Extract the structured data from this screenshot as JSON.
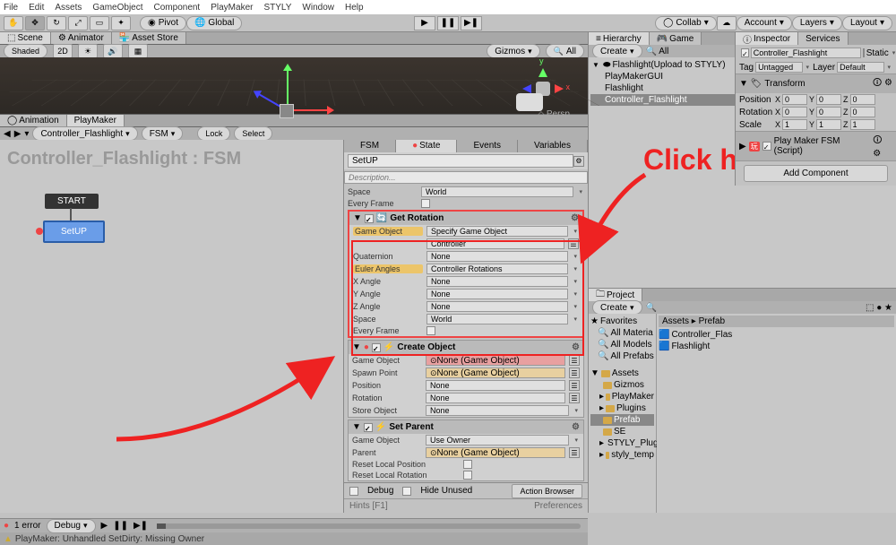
{
  "menubar": [
    "File",
    "Edit",
    "Assets",
    "GameObject",
    "Component",
    "PlayMaker",
    "STYLY",
    "Window",
    "Help"
  ],
  "toolbar": {
    "pivot": "Pivot",
    "global": "Global",
    "collab": "Collab",
    "account": "Account",
    "layers": "Layers",
    "layout": "Layout"
  },
  "scene_tabs": {
    "scene": "Scene",
    "animator": "Animator",
    "asset_store": "Asset Store"
  },
  "scene_toolbar": {
    "shaded": "Shaded",
    "twod": "2D",
    "gizmos": "Gizmos",
    "all": "All"
  },
  "persp": "Persp",
  "mid_tabs": {
    "animation": "Animation",
    "playmaker": "PlayMaker"
  },
  "pm_toolbar": {
    "controller": "Controller_Flashlight",
    "fsm": "FSM",
    "lock": "Lock",
    "select": "Select"
  },
  "fsm_title": "Controller_Flashlight : FSM",
  "nodes": {
    "start": "START",
    "setup": "SetUP"
  },
  "state_tabs": {
    "fsm": "FSM",
    "state": "State",
    "events": "Events",
    "variables": "Variables"
  },
  "state_name": "SetUP",
  "desc_placeholder": "Description...",
  "prev_rows": {
    "space": "Space",
    "space_val": "World",
    "every_frame": "Every Frame"
  },
  "get_rotation": {
    "title": "Get Rotation",
    "game_object": "Game Object",
    "game_object_val": "Specify Game Object",
    "controller_val": "Controller",
    "quaternion": "Quaternion",
    "quaternion_val": "None",
    "euler": "Euler Angles",
    "euler_val": "Controller Rotations",
    "x": "X Angle",
    "x_val": "None",
    "y": "Y Angle",
    "y_val": "None",
    "z": "Z Angle",
    "z_val": "None",
    "space": "Space",
    "space_val": "World",
    "every": "Every Frame"
  },
  "create_object": {
    "title": "Create Object",
    "game_object": "Game Object",
    "game_object_val": "None (Game Object)",
    "spawn": "Spawn Point",
    "spawn_val": "None (Game Object)",
    "position": "Position",
    "position_val": "None",
    "rotation": "Rotation",
    "rotation_val": "None",
    "store": "Store Object",
    "store_val": "None"
  },
  "set_parent": {
    "title": "Set Parent",
    "game_object": "Game Object",
    "game_object_val": "Use Owner",
    "parent": "Parent",
    "parent_val": "None (Game Object)",
    "reset_pos": "Reset Local Position",
    "reset_rot": "Reset Local Rotation"
  },
  "bottom": {
    "debug": "Debug",
    "hide": "Hide Unused",
    "browser": "Action Browser"
  },
  "hints": {
    "hints": "Hints [F1]",
    "prefs": "Preferences"
  },
  "hierarchy": {
    "tab_h": "Hierarchy",
    "tab_g": "Game",
    "create": "Create",
    "scene": "Flashlight(Upload to STYLY)",
    "items": [
      "PlayMakerGUI",
      "Flashlight",
      "Controller_Flashlight"
    ]
  },
  "project": {
    "tab": "Project",
    "create": "Create",
    "favorites": "Favorites",
    "fav_items": [
      "All Materia",
      "All Models",
      "All Prefabs"
    ],
    "assets": "Assets",
    "folders": [
      "Gizmos",
      "PlayMaker",
      "Plugins",
      "Prefab",
      "SE",
      "STYLY_Plug",
      "styly_temp"
    ],
    "breadcrumb": "Assets ▸ Prefab",
    "content": [
      "Controller_Flas",
      "Flashlight"
    ]
  },
  "inspector": {
    "tab_i": "Inspector",
    "tab_s": "Services",
    "name": "Controller_Flashlight",
    "static": "Static",
    "tag": "Tag",
    "tag_val": "Untagged",
    "layer": "Layer",
    "layer_val": "Default",
    "transform": "Transform",
    "pos": "Position",
    "rot": "Rotation",
    "scale": "Scale",
    "px": "0",
    "py": "0",
    "pz": "0",
    "rx": "0",
    "ry": "0",
    "rz": "0",
    "sx": "1",
    "sy": "1",
    "sz": "1",
    "fsm_comp": "Play Maker FSM (Script)",
    "add_comp": "Add Component"
  },
  "footer": {
    "errors": "1 error",
    "debug": "Debug",
    "status": "PlayMaker: Unhandled SetDirty: Missing Owner"
  },
  "annotation": {
    "click_here": "Click here"
  }
}
